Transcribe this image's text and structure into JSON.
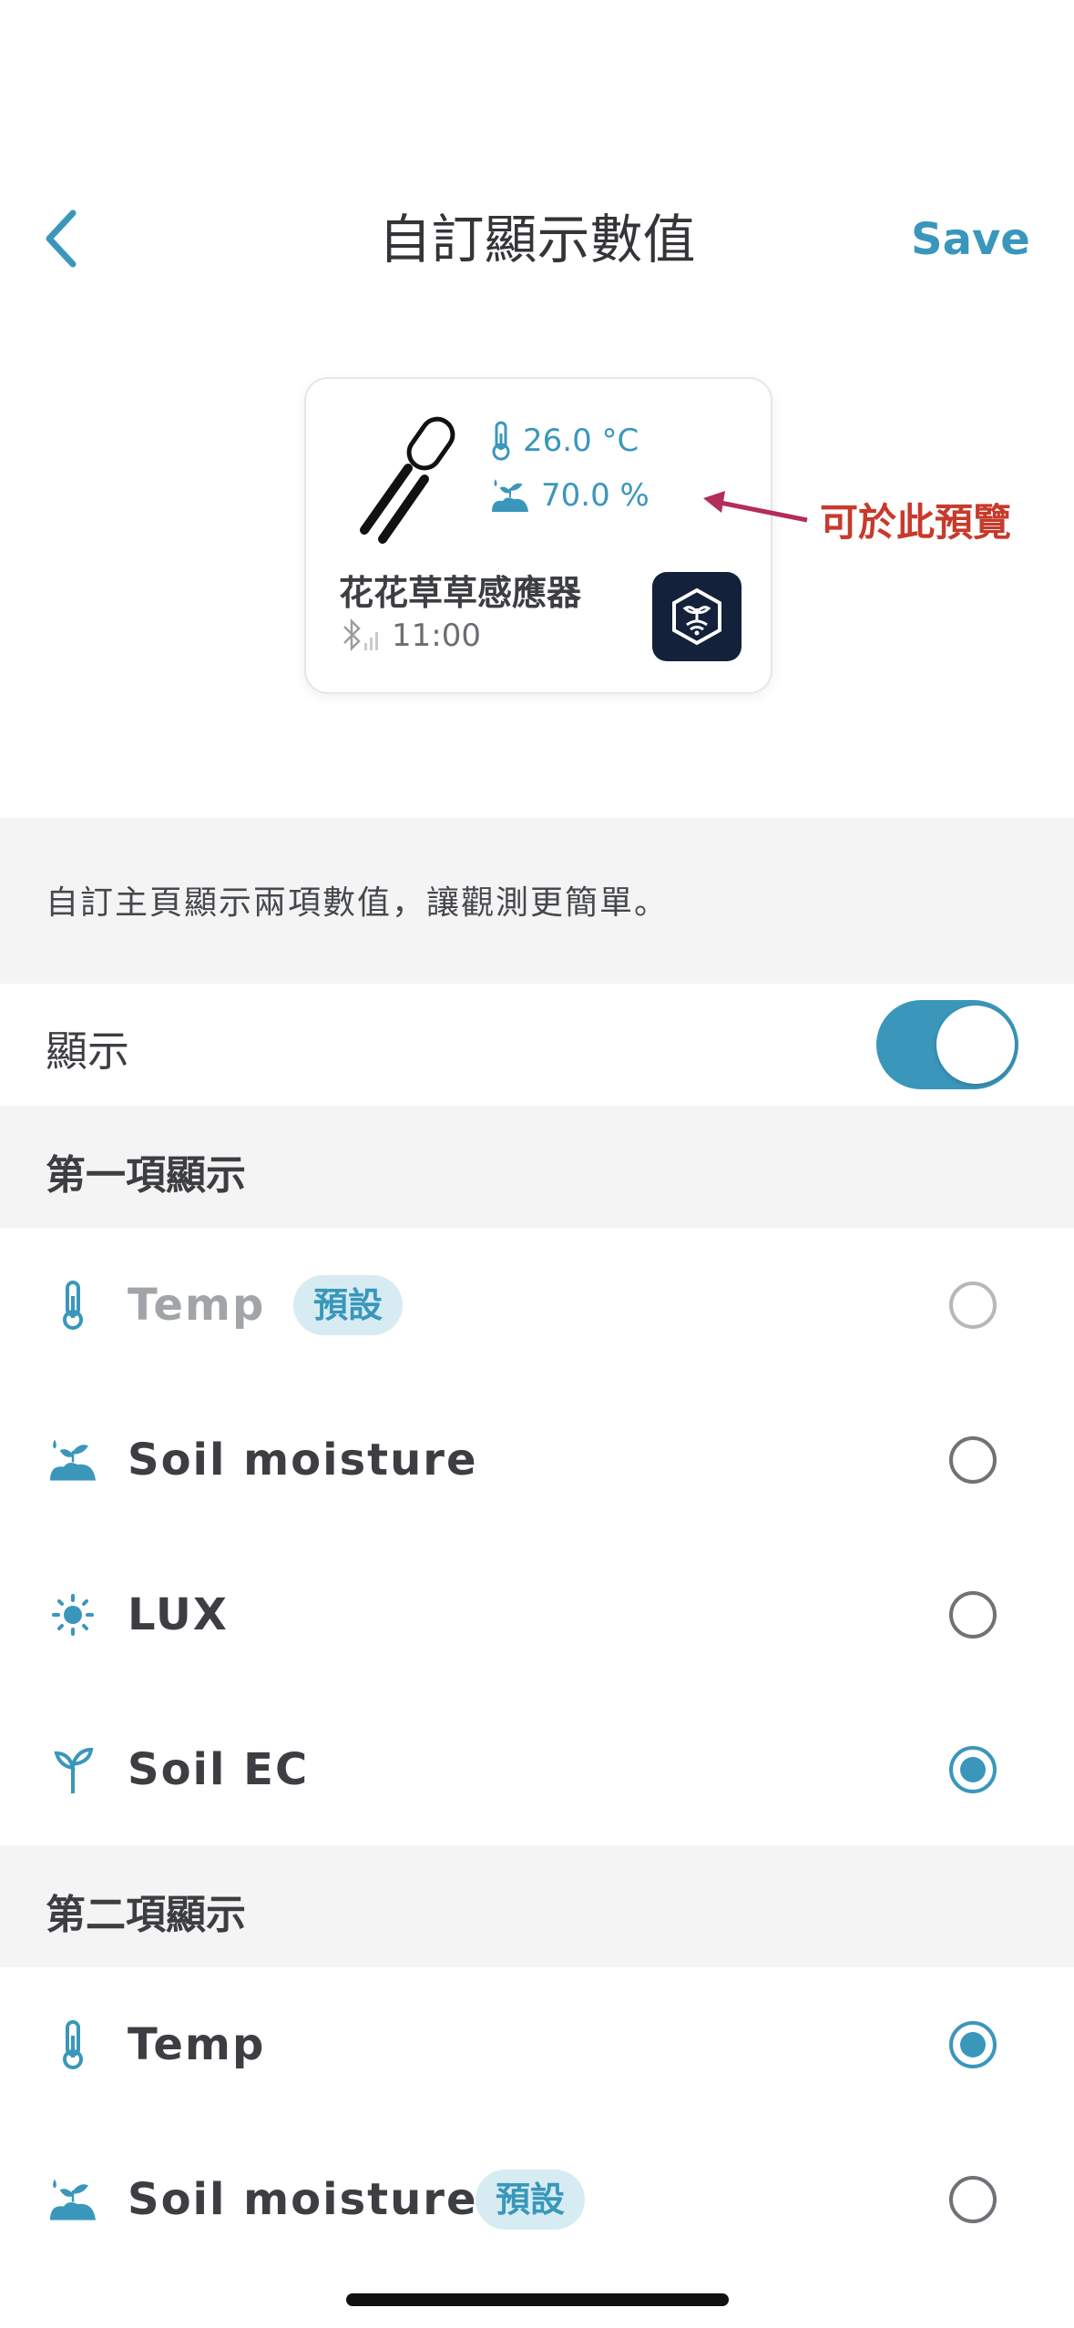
{
  "header": {
    "back_icon": "chevron-left-icon",
    "title": "自訂顯示數值",
    "save_label": "Save"
  },
  "preview": {
    "value1": "26.0 °C",
    "value1_icon": "thermometer-icon",
    "value2": "70.0 %",
    "value2_icon": "soil-moisture-icon",
    "device_name": "花花草草感應器",
    "status_time": "11:00",
    "status_icon": "bluetooth-signal-icon",
    "app_icon": "hive-logo-icon"
  },
  "annotation": {
    "text": "可於此預覽",
    "color": "#c73a2c"
  },
  "description": "自訂主頁顯示兩項數值，讓觀測更簡單。",
  "display_toggle": {
    "label": "顯示",
    "on": true
  },
  "section1": {
    "title": "第一項顯示",
    "options": [
      {
        "label": "Temp",
        "tag": "預設",
        "icon": "thermometer-icon",
        "selected": false,
        "disabled": true
      },
      {
        "label": "Soil moisture",
        "icon": "soil-moisture-icon",
        "selected": false
      },
      {
        "label": "LUX",
        "icon": "sun-icon",
        "selected": false
      },
      {
        "label": "Soil EC",
        "icon": "sprout-icon",
        "selected": true
      }
    ]
  },
  "section2": {
    "title": "第二項顯示",
    "options": [
      {
        "label": "Temp",
        "icon": "thermometer-icon",
        "selected": true
      },
      {
        "label": "Soil moisture",
        "tag": "預設",
        "icon": "soil-moisture-icon",
        "selected": false
      }
    ]
  },
  "colors": {
    "accent": "#3a97bb",
    "section_bg": "#f4f4f5",
    "tag_bg": "#d6ecf2"
  }
}
